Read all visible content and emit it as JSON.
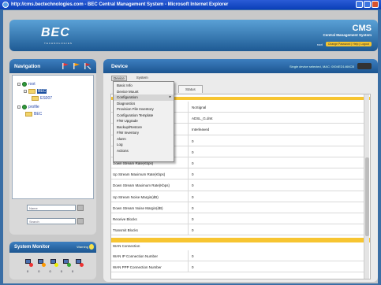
{
  "window": {
    "title": "http://cms.bectechnologies.com - BEC Central Management System - Microsoft Internet Explorer"
  },
  "header": {
    "logo": "BEC",
    "logo_sub": "TECHNOLOGIES",
    "cms_title": "CMS",
    "cms_subtitle": "Central Management System",
    "link_user": "root",
    "link_password": "Change Password | Help | Logout"
  },
  "navigation": {
    "title": "Navigation",
    "tree": [
      {
        "label": "root"
      },
      {
        "label": "BEC"
      },
      {
        "label": "ES007"
      },
      {
        "label": "profile"
      },
      {
        "label": "BEC"
      }
    ],
    "search": {
      "name_value": "Name",
      "search_value": "Search"
    }
  },
  "system_monitor": {
    "title": "System Monitor",
    "warning_label": "Warning",
    "counts": [
      "0",
      "0",
      "0",
      "0",
      "0"
    ]
  },
  "device": {
    "title": "Device",
    "selection_info": "Single device selected, MAC: 0004ED1466CB",
    "menu": [
      "Device",
      "System"
    ],
    "dropdown": [
      {
        "label": "Basic Info",
        "submenu": false
      },
      {
        "label": "Device Mount",
        "submenu": false
      },
      {
        "label": "Configuration",
        "submenu": true
      },
      {
        "label": "Diagnostics",
        "submenu": false
      },
      {
        "label": "Provision File Inventory",
        "submenu": false
      },
      {
        "label": "Configuration Template",
        "submenu": false
      },
      {
        "label": "F/W Upgrade",
        "submenu": false
      },
      {
        "label": "Backup/Restore",
        "submenu": false
      },
      {
        "label": "F/W Inventory",
        "submenu": false
      },
      {
        "label": "Alarm",
        "submenu": false
      },
      {
        "label": "Log",
        "submenu": false
      },
      {
        "label": "Actions",
        "submenu": false
      }
    ],
    "tab": "Status",
    "rows": [
      {
        "key": "",
        "value": "NoSignal"
      },
      {
        "key": "",
        "value": "ADSL_G.dmt"
      },
      {
        "key": "",
        "value": "Interleaved"
      },
      {
        "key": "",
        "value": "0"
      },
      {
        "key": "",
        "value": "0"
      },
      {
        "key": "Down Stream Rate(Kbps)",
        "value": "0"
      },
      {
        "key": "Up Stream Maximum Rate(Kbps)",
        "value": "0"
      },
      {
        "key": "Down Stream Maximum Rate(Kbps)",
        "value": "0"
      },
      {
        "key": "Up Stream Noise Margin(dB)",
        "value": "0"
      },
      {
        "key": "Down Stream Noise Margin(dB)",
        "value": "0"
      },
      {
        "key": "Receive Blocks",
        "value": "0"
      },
      {
        "key": "Transmit Blocks",
        "value": "0"
      }
    ],
    "wan_section": "WAN Connection",
    "wan_rows": [
      {
        "key": "WAN IP Connection Number",
        "value": "0"
      },
      {
        "key": "WAN PPP Connection Number",
        "value": "0"
      }
    ]
  },
  "colors": {
    "accent_bar": "#f7c531",
    "header_blue": "#1c5590"
  }
}
